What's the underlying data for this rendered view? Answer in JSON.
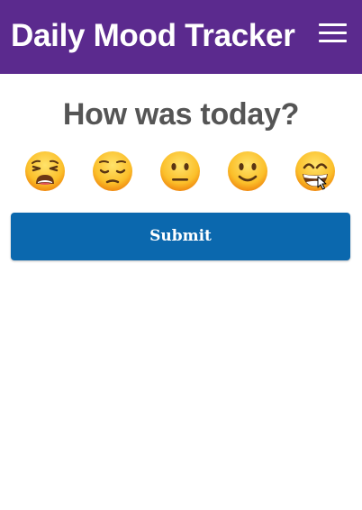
{
  "header": {
    "title": "Daily Mood Tracker",
    "background_color": "#5b2a8e",
    "menu_icon": "hamburger-menu-icon"
  },
  "prompt": {
    "question": "How was today?"
  },
  "moods": [
    {
      "emoji": "😩",
      "icon": "weary-face-icon"
    },
    {
      "emoji": "😔",
      "icon": "pensive-face-icon"
    },
    {
      "emoji": "😐",
      "icon": "neutral-face-icon"
    },
    {
      "emoji": "🙂",
      "icon": "slightly-smiling-face-icon"
    },
    {
      "emoji": "😁",
      "icon": "beaming-face-icon"
    }
  ],
  "actions": {
    "submit_label": "Submit",
    "submit_color": "#0b68ae"
  }
}
